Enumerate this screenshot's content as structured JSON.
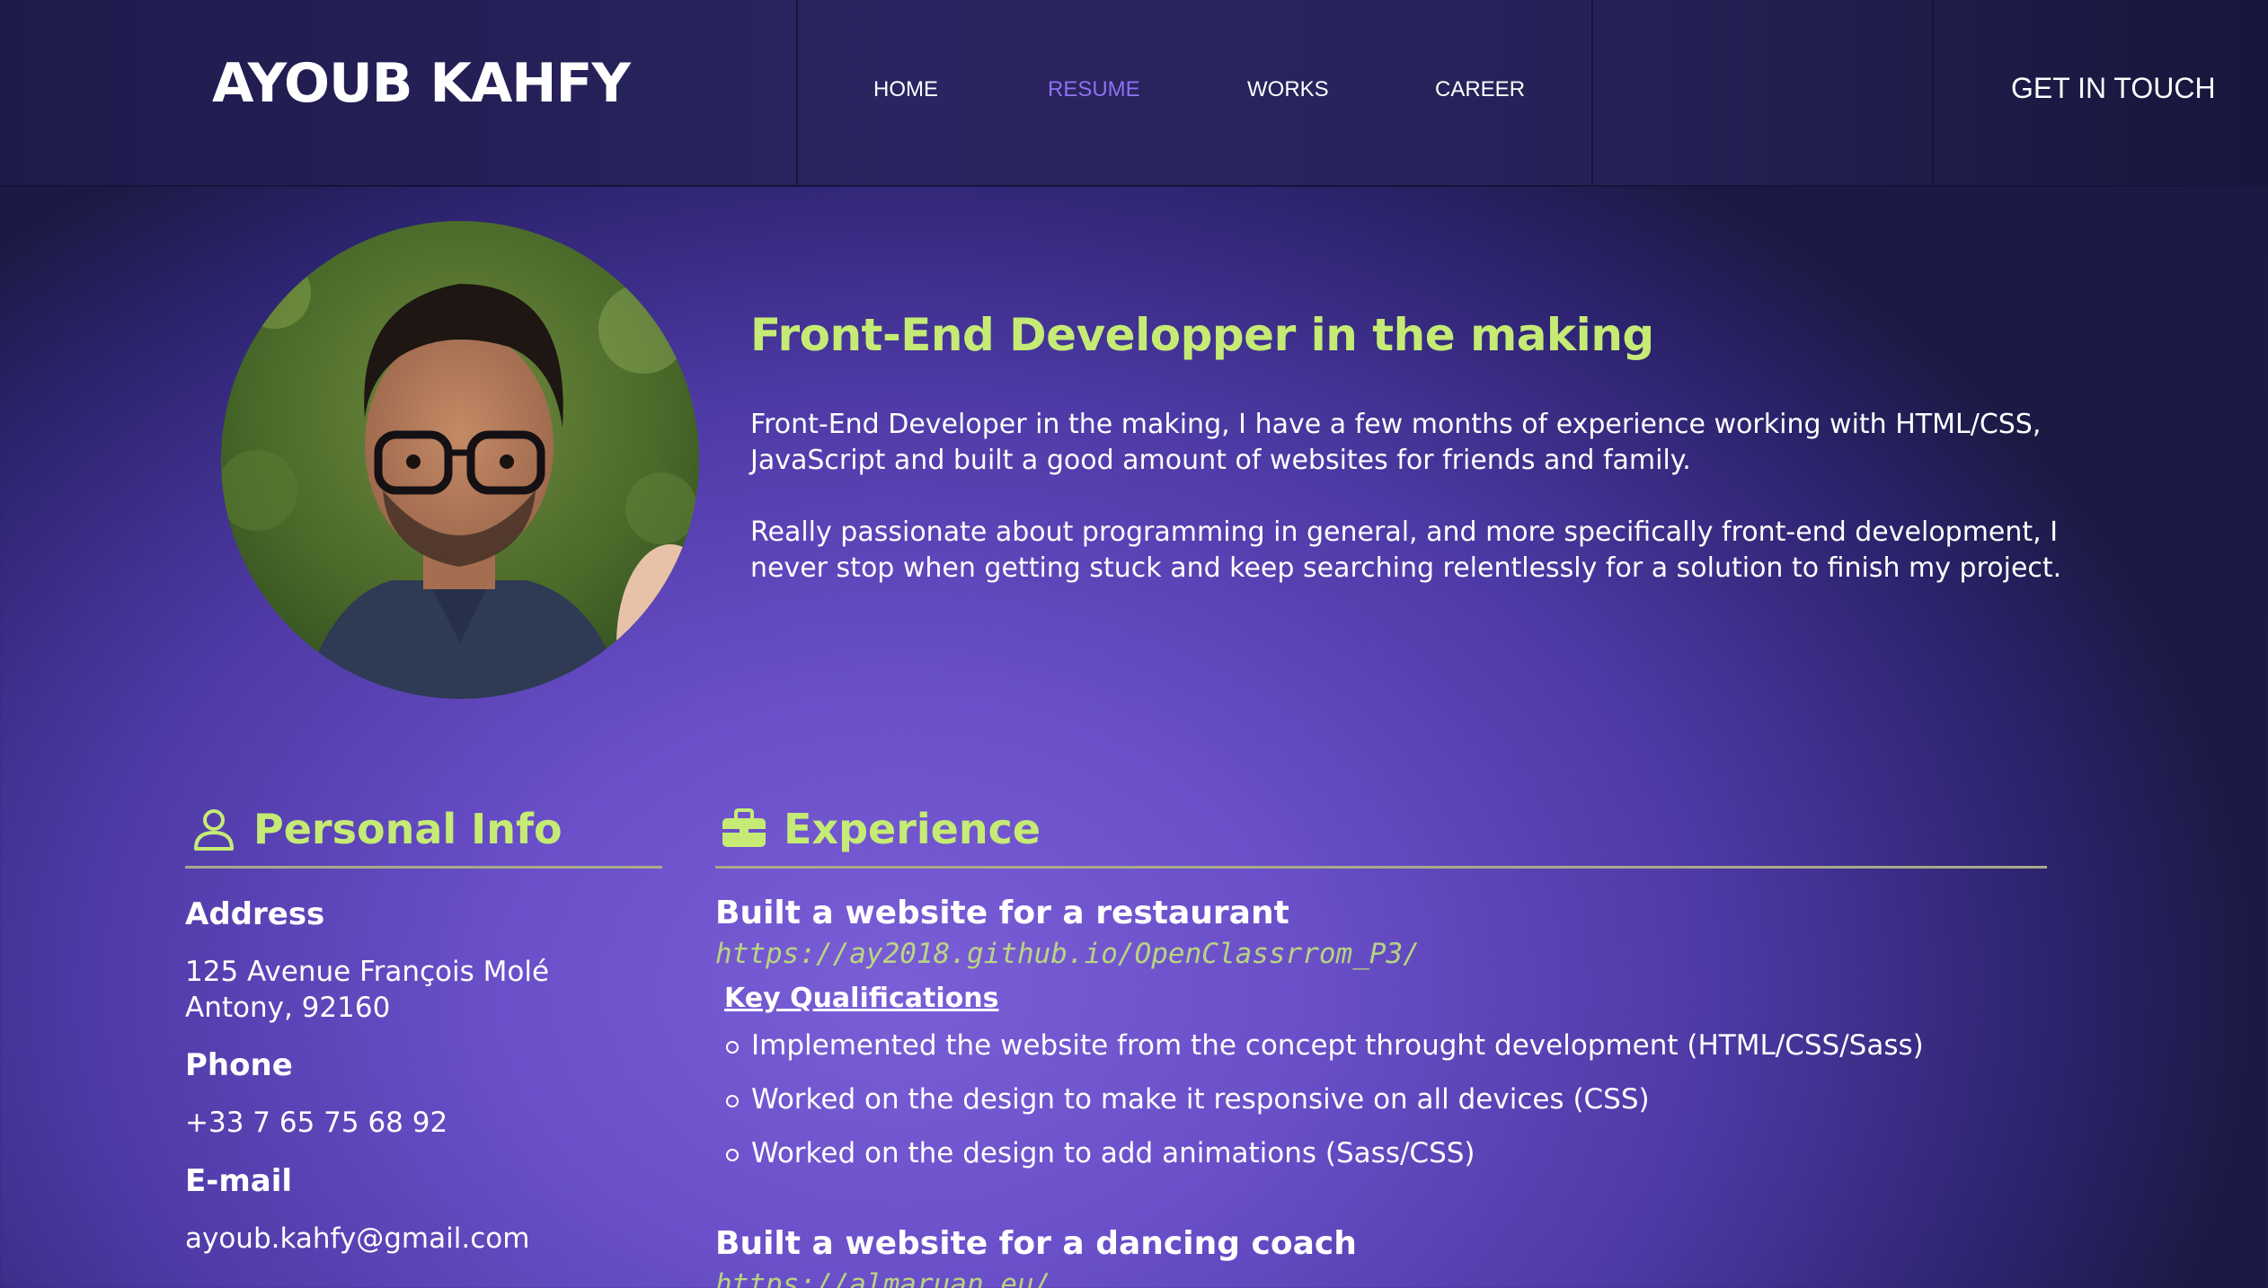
{
  "header": {
    "logo": "AYOUB KAHFY",
    "nav": [
      {
        "label": "HOME",
        "active": false
      },
      {
        "label": "RESUME",
        "active": true
      },
      {
        "label": "WORKS",
        "active": false
      },
      {
        "label": "CAREER",
        "active": false
      }
    ],
    "cta_label": "GET IN TOUCH"
  },
  "hero": {
    "title": "Front-End Developper in the making",
    "paragraphs": [
      "Front-End Developer in the making, I have a few months of experience working with HTML/CSS, JavaScript and built a good amount of websites for friends and family.",
      "Really passionate about programming in general, and more specifically front-end development, I never stop when getting stuck and keep searching relentlessly for a solution to finish my project."
    ]
  },
  "personal_info": {
    "heading": "Personal Info",
    "icon": "user-icon",
    "address_label": "Address",
    "address_line1": "125 Avenue François Molé",
    "address_line2": "Antony, 92160",
    "phone_label": "Phone",
    "phone": "+33 7 65 75 68 92",
    "email_label": "E-mail",
    "email": "ayoub.kahfy@gmail.com"
  },
  "experience": {
    "heading": "Experience",
    "icon": "briefcase-icon",
    "jobs": [
      {
        "title": "Built a website for a restaurant",
        "link": "https://ay2018.github.io/OpenClassrrom_P3/",
        "qualifications_label": "Key Qualifications",
        "qualifications": [
          "Implemented the website from the concept throught development (HTML/CSS/Sass)",
          "Worked on the design to make it responsive on all devices (CSS)",
          "Worked on the design to add animations (Sass/CSS)"
        ]
      },
      {
        "title": "Built a website for a dancing coach",
        "link": "https://almaruan.eu/"
      }
    ]
  },
  "colors": {
    "accent_green": "#c6eb75",
    "accent_purple": "#8f6ff0",
    "header_bg": "#242055"
  }
}
